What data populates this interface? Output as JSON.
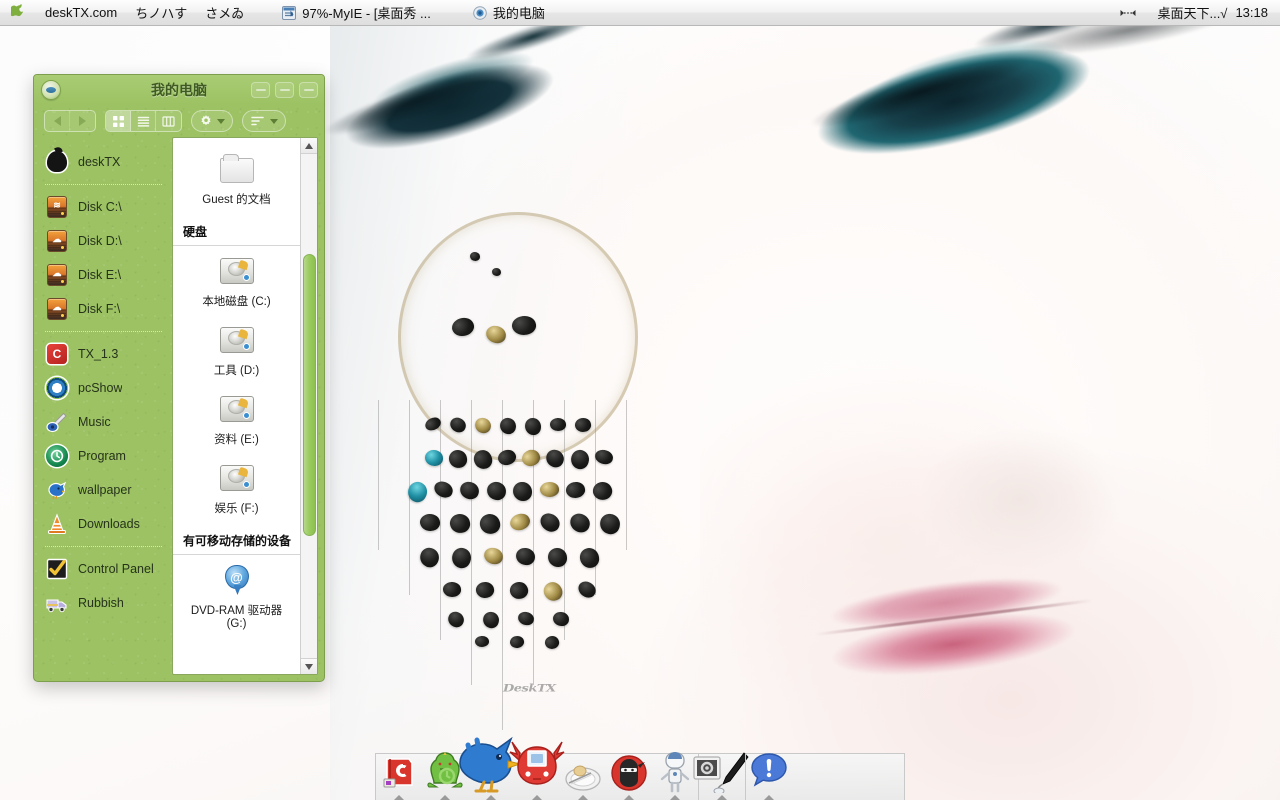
{
  "menubar": {
    "apple_icon": "apple-logo-icon",
    "items": [
      {
        "label": "deskTX.com",
        "icon": null
      },
      {
        "label": "ちノハす",
        "icon": null
      },
      {
        "label": "さメゐ",
        "icon": null
      },
      {
        "label": "97%-MyIE - [桌面秀 ...",
        "icon": "myie-window-icon"
      },
      {
        "label": "我的电脑",
        "icon": "my-computer-icon"
      }
    ],
    "right": {
      "expand_icon": "expand-arrows-icon",
      "status_label": "桌面天下...√",
      "clock": "13:18"
    }
  },
  "window": {
    "title": "我的电脑",
    "eye_icon": "eye-badge-icon",
    "controls": [
      {
        "name": "minimize-button",
        "label": ""
      },
      {
        "name": "maximize-button",
        "label": ""
      },
      {
        "name": "close-button",
        "label": ""
      }
    ],
    "toolbar": {
      "back_label": "",
      "forward_label": "",
      "view_icon_label": "",
      "view_list_label": "",
      "view_column_label": "",
      "action_label": "",
      "arrange_label": ""
    },
    "sidebar": {
      "groups": [
        {
          "items": [
            {
              "label": "deskTX",
              "icon": "apple-icon"
            }
          ]
        },
        {
          "items": [
            {
              "label": "Disk C:\\",
              "icon": "disk-drive-icon"
            },
            {
              "label": "Disk D:\\",
              "icon": "disk-drive-icon"
            },
            {
              "label": "Disk E:\\",
              "icon": "disk-drive-icon"
            },
            {
              "label": "Disk F:\\",
              "icon": "disk-drive-icon"
            }
          ]
        },
        {
          "items": [
            {
              "label": "TX_1.3",
              "icon": "tx-book-icon"
            },
            {
              "label": "pcShow",
              "icon": "eye-icon"
            },
            {
              "label": "Music",
              "icon": "guitar-icon"
            },
            {
              "label": "Program",
              "icon": "clock-disc-icon"
            },
            {
              "label": "wallpaper",
              "icon": "blue-bird-icon"
            },
            {
              "label": "Downloads",
              "icon": "traffic-cone-icon"
            }
          ]
        },
        {
          "items": [
            {
              "label": "Control Panel",
              "icon": "checkmark-icon"
            },
            {
              "label": "Rubbish",
              "icon": "truck-icon"
            }
          ]
        }
      ]
    },
    "content": {
      "items": [
        {
          "label": "Guest 的文档",
          "icon": "folder-icon",
          "type": "item"
        },
        {
          "label": "硬盘",
          "type": "group"
        },
        {
          "label": "本地磁盘 (C:)",
          "icon": "hard-disk-icon",
          "type": "item"
        },
        {
          "label": "工具 (D:)",
          "icon": "hard-disk-icon",
          "type": "item"
        },
        {
          "label": "资料 (E:)",
          "icon": "hard-disk-icon",
          "type": "item"
        },
        {
          "label": "娱乐 (F:)",
          "icon": "hard-disk-icon",
          "type": "item"
        },
        {
          "label": "有可移动存储的设备",
          "type": "group"
        },
        {
          "label": "DVD-RAM 驱动器 (G:)",
          "icon": "dvd-ram-icon",
          "type": "item"
        }
      ],
      "scrollbar": {
        "up_icon": "scroll-up-arrow-icon",
        "down_icon": "scroll-down-arrow-icon"
      }
    }
  },
  "desktop": {
    "watermark": "DeskTX"
  },
  "dock": {
    "sections": [
      {
        "items": [
          {
            "name": "dock-item-red-book",
            "icon": "red-book-app-icon"
          },
          {
            "name": "dock-item-green-dino",
            "icon": "green-dinosaur-icon"
          },
          {
            "name": "dock-item-blue-bird",
            "icon": "blue-bird-icon"
          },
          {
            "name": "dock-item-red-monster",
            "icon": "red-monster-icon"
          },
          {
            "name": "dock-item-plate",
            "icon": "plate-bread-icon"
          },
          {
            "name": "dock-item-ninja",
            "icon": "ninja-icon"
          },
          {
            "name": "dock-item-robot",
            "icon": "robot-icon"
          }
        ]
      },
      {
        "items": [
          {
            "name": "dock-item-settings-pen",
            "icon": "settings-pen-icon"
          }
        ]
      },
      {
        "items": [
          {
            "name": "dock-item-alert",
            "icon": "blue-alert-balloon-icon"
          }
        ]
      }
    ]
  },
  "colors": {
    "window_green": "#9cc263",
    "window_border": "#7d9f4d",
    "title_text": "#3f5a22",
    "menubar_bg": "#f0f0f0",
    "scrollbar_thumb": "#9ccc60"
  }
}
